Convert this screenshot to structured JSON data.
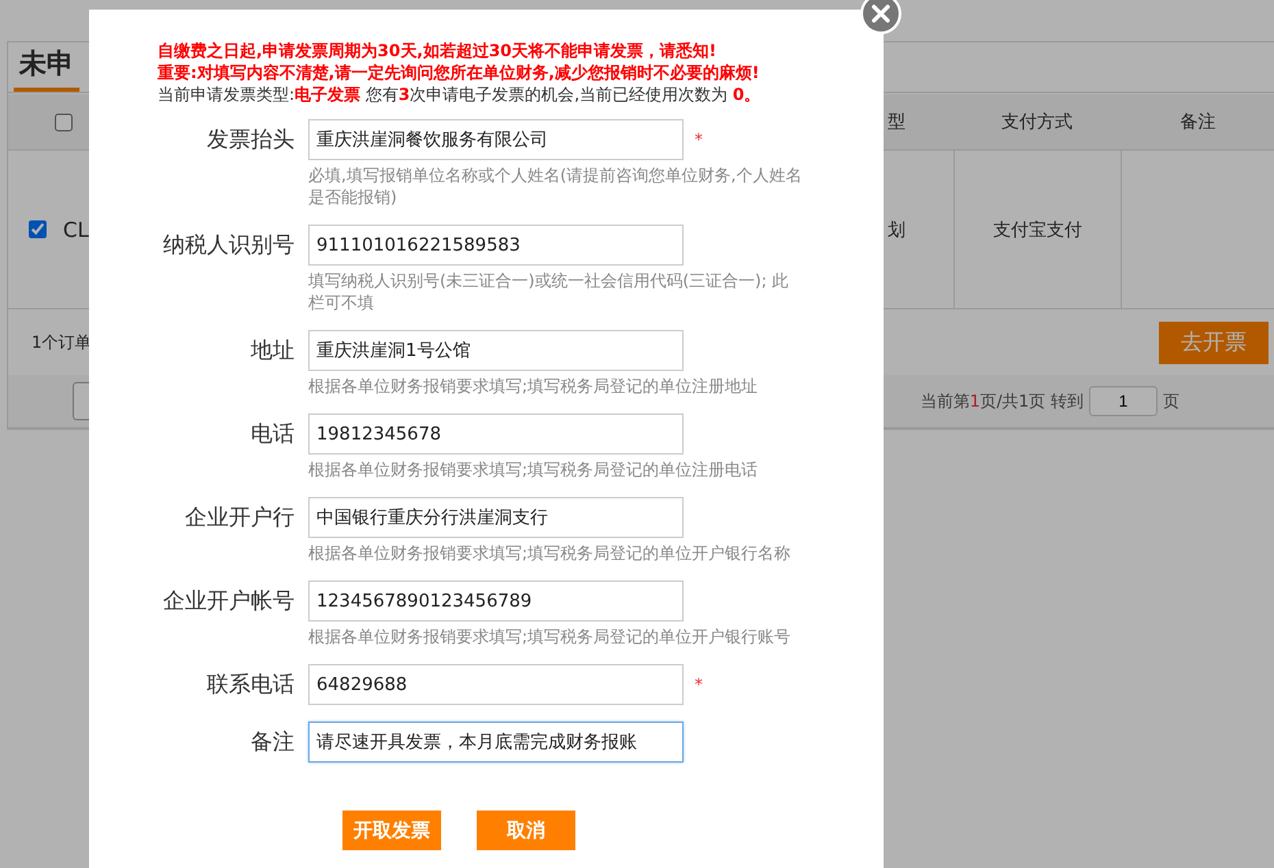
{
  "background_page": {
    "tab_title": "未申",
    "table": {
      "columns": [
        {
          "kind": "checkbox",
          "checked": false
        },
        {
          "kind": "text",
          "label": "型"
        },
        {
          "kind": "text",
          "label": "支付方式"
        },
        {
          "kind": "text",
          "label": "备注"
        }
      ],
      "rows": [
        {
          "checked": true,
          "cells": [
            "CL",
            "划",
            "支付宝支付",
            ""
          ]
        }
      ]
    },
    "order_count": "1个订单",
    "action_button": "去开票",
    "pagination": {
      "status": "当前第**1**页/共1页 转到",
      "page_input": "1",
      "suffix": "页"
    }
  },
  "dialog": {
    "notices": [
      {
        "text": "自缴费之日起,申请发票周期为30天,如若超过30天将不能申请发票，请悉知!",
        "kind": "warning"
      },
      {
        "text": "重要:对填写内容不清楚,请一定先询问您所在单位财务,减少您报销时不必要的麻烦!",
        "kind": "warning"
      },
      {
        "text": "当前申请发票类型:**电子发票** 您有**3**次申请电子发票的机会,当前已经使用次数为 **0。**",
        "kind": "info"
      }
    ],
    "fields": [
      {
        "label": "发票抬头",
        "value": "重庆洪崖洞餐饮服务有限公司",
        "required": true,
        "focused": false,
        "hint": "必填,填写报销单位名称或个人姓名(请提前咨询您单位财务,个人姓名是否能报销)"
      },
      {
        "label": "纳税人识别号",
        "value": "911101016221589583",
        "required": false,
        "focused": false,
        "hint": "填写纳税人识别号(未三证合一)或统一社会信用代码(三证合一); 此栏可不填"
      },
      {
        "label": "地址",
        "value": "重庆洪崖洞1号公馆",
        "required": false,
        "focused": false,
        "hint": "根据各单位财务报销要求填写;填写税务局登记的单位注册地址"
      },
      {
        "label": "电话",
        "value": "19812345678",
        "required": false,
        "focused": false,
        "hint": "根据各单位财务报销要求填写;填写税务局登记的单位注册电话"
      },
      {
        "label": "企业开户行",
        "value": "中国银行重庆分行洪崖洞支行",
        "required": false,
        "focused": false,
        "hint": "根据各单位财务报销要求填写;填写税务局登记的单位开户银行名称"
      },
      {
        "label": "企业开户帐号",
        "value": "1234567890123456789",
        "required": false,
        "focused": false,
        "hint": "根据各单位财务报销要求填写;填写税务局登记的单位开户银行账号"
      },
      {
        "label": "联系电话",
        "value": "64829688",
        "required": true,
        "focused": false
      },
      {
        "label": "备注",
        "value": "请尽速开具发票，本月底需完成财务报账",
        "required": false,
        "focused": true
      }
    ],
    "buttons": [
      "开取发票",
      "取消"
    ],
    "required_mark": "*"
  }
}
